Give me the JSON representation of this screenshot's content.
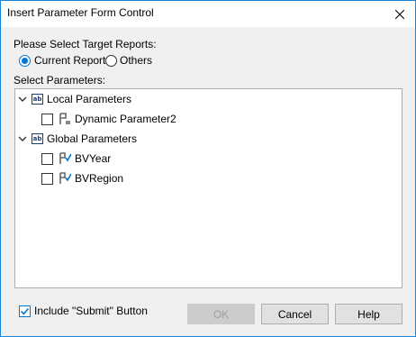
{
  "window": {
    "title": "Insert Parameter Form Control"
  },
  "target": {
    "label": "Please Select Target Reports:",
    "options": [
      {
        "label": "Current Report",
        "selected": true
      },
      {
        "label": "Others",
        "selected": false
      }
    ]
  },
  "parameters": {
    "label": "Select Parameters:",
    "groups": [
      {
        "label": "Local Parameters",
        "items": [
          {
            "label": "Dynamic Parameter2",
            "checked": false
          }
        ]
      },
      {
        "label": "Global Parameters",
        "items": [
          {
            "label": "BVYear",
            "checked": false
          },
          {
            "label": "BVRegion",
            "checked": false
          }
        ]
      }
    ]
  },
  "include_submit": {
    "label": "Include \"Submit\" Button",
    "checked": true
  },
  "buttons": {
    "ok": "OK",
    "cancel": "Cancel",
    "help": "Help"
  },
  "colors": {
    "accent": "#0078d7",
    "border": "#1883d7",
    "background": "#f0f0f0"
  }
}
